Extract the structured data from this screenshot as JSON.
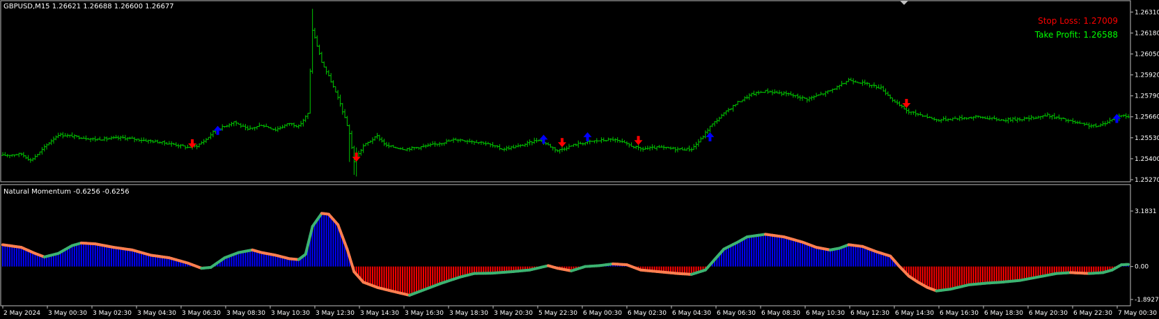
{
  "main": {
    "header": "GBPUSD,M15  1.26621 1.26688 1.26600 1.26677",
    "stop_loss": "Stop Loss: 1.27009",
    "take_profit": "Take Profit: 1.26588",
    "price_ticks": [
      "1.26310",
      "1.26180",
      "1.26050",
      "1.25920",
      "1.25790",
      "1.25660",
      "1.25530",
      "1.25400",
      "1.25270"
    ],
    "ylim": [
      1.2527,
      1.2635
    ]
  },
  "indicator": {
    "header": "Natural Momentum -0.6256 -0.6256",
    "ticks": [
      "3.1831",
      "0.00",
      "-1.8927"
    ],
    "ylim": [
      -1.8927,
      3.1831
    ]
  },
  "time_labels": [
    "2 May 2024",
    "3 May 00:30",
    "3 May 02:30",
    "3 May 04:30",
    "3 May 06:30",
    "3 May 08:30",
    "3 May 10:30",
    "3 May 12:30",
    "3 May 14:30",
    "3 May 16:30",
    "3 May 18:30",
    "3 May 20:30",
    "5 May 22:30",
    "6 May 00:30",
    "6 May 02:30",
    "6 May 04:30",
    "6 May 06:30",
    "6 May 08:30",
    "6 May 10:30",
    "6 May 12:30",
    "6 May 14:30",
    "6 May 16:30",
    "6 May 18:30",
    "6 May 20:30",
    "6 May 22:30",
    "7 May 00:30"
  ],
  "colors": {
    "bars": "#00c800",
    "sell_arrow": "#ff0000",
    "buy_arrow": "#0000ff",
    "hist_pos": "#0000ff",
    "hist_neg": "#ff0000",
    "line_up": "#3cb371",
    "line_down": "#ff7f50",
    "stop_loss": "#ff0000",
    "take_profit": "#00ff00"
  },
  "chart_data": [
    {
      "type": "ohlc",
      "title": "GBPUSD,M15",
      "ylim": [
        1.2527,
        1.2635
      ],
      "close_path": [
        [
          0,
          1.2542
        ],
        [
          8,
          1.2543
        ],
        [
          12,
          1.2539
        ],
        [
          16,
          1.2544
        ],
        [
          20,
          1.255
        ],
        [
          24,
          1.2555
        ],
        [
          30,
          1.2554
        ],
        [
          40,
          1.2552
        ],
        [
          52,
          1.2553
        ],
        [
          64,
          1.2551
        ],
        [
          74,
          1.2549
        ],
        [
          80,
          1.2547
        ],
        [
          84,
          1.2548
        ],
        [
          88,
          1.2552
        ],
        [
          92,
          1.2558
        ],
        [
          96,
          1.256
        ],
        [
          100,
          1.2563
        ],
        [
          106,
          1.2558
        ],
        [
          112,
          1.2561
        ],
        [
          118,
          1.2558
        ],
        [
          124,
          1.2562
        ],
        [
          128,
          1.256
        ],
        [
          132,
          1.2568
        ],
        [
          134,
          1.262
        ],
        [
          138,
          1.26
        ],
        [
          142,
          1.2588
        ],
        [
          146,
          1.2574
        ],
        [
          150,
          1.2556
        ],
        [
          152,
          1.2538
        ],
        [
          156,
          1.2548
        ],
        [
          162,
          1.2554
        ],
        [
          166,
          1.2548
        ],
        [
          174,
          1.2546
        ],
        [
          184,
          1.2548
        ],
        [
          196,
          1.2552
        ],
        [
          208,
          1.255
        ],
        [
          216,
          1.2546
        ],
        [
          224,
          1.2548
        ],
        [
          232,
          1.2552
        ],
        [
          240,
          1.2545
        ],
        [
          248,
          1.2549
        ],
        [
          256,
          1.2551
        ],
        [
          264,
          1.2552
        ],
        [
          270,
          1.2549
        ],
        [
          276,
          1.2546
        ],
        [
          284,
          1.2547
        ],
        [
          292,
          1.2546
        ],
        [
          298,
          1.2546
        ],
        [
          302,
          1.2552
        ],
        [
          306,
          1.256
        ],
        [
          312,
          1.2568
        ],
        [
          318,
          1.2575
        ],
        [
          324,
          1.258
        ],
        [
          330,
          1.2582
        ],
        [
          340,
          1.258
        ],
        [
          348,
          1.2577
        ],
        [
          356,
          1.2581
        ],
        [
          362,
          1.2585
        ],
        [
          366,
          1.2589
        ],
        [
          372,
          1.2587
        ],
        [
          380,
          1.2584
        ],
        [
          386,
          1.2575
        ],
        [
          392,
          1.2569
        ],
        [
          398,
          1.2567
        ],
        [
          404,
          1.2564
        ],
        [
          412,
          1.2565
        ],
        [
          422,
          1.2566
        ],
        [
          432,
          1.2564
        ],
        [
          444,
          1.2565
        ],
        [
          452,
          1.2567
        ],
        [
          460,
          1.2564
        ],
        [
          468,
          1.2561
        ],
        [
          474,
          1.256
        ],
        [
          478,
          1.2563
        ],
        [
          484,
          1.2567
        ],
        [
          487,
          1.2566
        ]
      ],
      "signals": [
        {
          "type": "sell",
          "x": 82,
          "price": 1.25495
        },
        {
          "type": "buy",
          "x": 93,
          "price": 1.25574
        },
        {
          "type": "sell",
          "x": 153,
          "price": 1.25412
        },
        {
          "type": "buy",
          "x": 234,
          "price": 1.25519
        },
        {
          "type": "sell",
          "x": 242,
          "price": 1.25502
        },
        {
          "type": "buy",
          "x": 253,
          "price": 1.25534
        },
        {
          "type": "sell",
          "x": 275,
          "price": 1.25515
        },
        {
          "type": "buy",
          "x": 306,
          "price": 1.25534
        },
        {
          "type": "sell",
          "x": 391,
          "price": 1.25745
        },
        {
          "type": "buy",
          "x": 482,
          "price": 1.25648
        }
      ]
    },
    {
      "type": "histogram+line",
      "title": "Natural Momentum",
      "ylim": [
        -1.8927,
        3.1831
      ],
      "values": [
        [
          0,
          1.25
        ],
        [
          8,
          1.1
        ],
        [
          14,
          0.75
        ],
        [
          18,
          0.55
        ],
        [
          24,
          0.75
        ],
        [
          30,
          1.2
        ],
        [
          34,
          1.35
        ],
        [
          40,
          1.3
        ],
        [
          48,
          1.1
        ],
        [
          56,
          0.95
        ],
        [
          64,
          0.65
        ],
        [
          72,
          0.5
        ],
        [
          80,
          0.2
        ],
        [
          86,
          -0.1
        ],
        [
          90,
          -0.05
        ],
        [
          96,
          0.5
        ],
        [
          102,
          0.8
        ],
        [
          108,
          0.95
        ],
        [
          112,
          0.8
        ],
        [
          118,
          0.65
        ],
        [
          124,
          0.45
        ],
        [
          128,
          0.4
        ],
        [
          131,
          0.7
        ],
        [
          134,
          2.3
        ],
        [
          138,
          3.05
        ],
        [
          141,
          3.0
        ],
        [
          145,
          2.4
        ],
        [
          149,
          1.0
        ],
        [
          152,
          -0.3
        ],
        [
          156,
          -0.9
        ],
        [
          162,
          -1.2
        ],
        [
          168,
          -1.4
        ],
        [
          176,
          -1.65
        ],
        [
          182,
          -1.35
        ],
        [
          190,
          -0.95
        ],
        [
          198,
          -0.6
        ],
        [
          204,
          -0.4
        ],
        [
          212,
          -0.38
        ],
        [
          220,
          -0.3
        ],
        [
          228,
          -0.2
        ],
        [
          236,
          0.05
        ],
        [
          240,
          -0.1
        ],
        [
          246,
          -0.25
        ],
        [
          252,
          0.0
        ],
        [
          258,
          0.05
        ],
        [
          264,
          0.15
        ],
        [
          270,
          0.1
        ],
        [
          276,
          -0.2
        ],
        [
          284,
          -0.3
        ],
        [
          292,
          -0.4
        ],
        [
          298,
          -0.45
        ],
        [
          304,
          -0.2
        ],
        [
          308,
          0.4
        ],
        [
          312,
          1.0
        ],
        [
          318,
          1.4
        ],
        [
          322,
          1.7
        ],
        [
          330,
          1.85
        ],
        [
          338,
          1.7
        ],
        [
          346,
          1.4
        ],
        [
          352,
          1.1
        ],
        [
          358,
          0.95
        ],
        [
          362,
          1.05
        ],
        [
          366,
          1.25
        ],
        [
          372,
          1.15
        ],
        [
          378,
          0.85
        ],
        [
          384,
          0.6
        ],
        [
          388,
          0.0
        ],
        [
          392,
          -0.55
        ],
        [
          396,
          -0.9
        ],
        [
          400,
          -1.2
        ],
        [
          404,
          -1.4
        ],
        [
          410,
          -1.3
        ],
        [
          418,
          -1.05
        ],
        [
          426,
          -0.95
        ],
        [
          432,
          -0.9
        ],
        [
          440,
          -0.8
        ],
        [
          448,
          -0.6
        ],
        [
          456,
          -0.4
        ],
        [
          462,
          -0.35
        ],
        [
          470,
          -0.4
        ],
        [
          476,
          -0.35
        ],
        [
          480,
          -0.2
        ],
        [
          484,
          0.1
        ],
        [
          487,
          0.12
        ]
      ]
    }
  ]
}
